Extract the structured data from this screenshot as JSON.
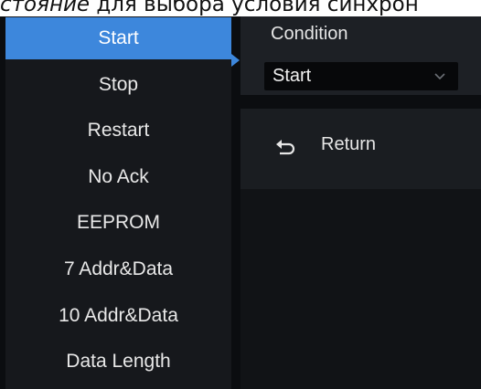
{
  "caption": {
    "italic_text": "стояние",
    "text": " для выбора условия синхрон"
  },
  "menu": {
    "items": [
      {
        "label": "Start",
        "selected": true
      },
      {
        "label": "Stop",
        "selected": false
      },
      {
        "label": "Restart",
        "selected": false
      },
      {
        "label": "No Ack",
        "selected": false
      },
      {
        "label": "EEPROM",
        "selected": false
      },
      {
        "label": "7 Addr&Data",
        "selected": false
      },
      {
        "label": "10 Addr&Data",
        "selected": false
      },
      {
        "label": "Data Length",
        "selected": false
      }
    ]
  },
  "panel": {
    "condition_label": "Condition",
    "condition_value": "Start",
    "return_label": "Return",
    "icons": {
      "dropdown": "chevron-down-icon",
      "return": "return-icon"
    }
  },
  "colors": {
    "accent": "#3d87dc",
    "menu_bg": "#16181c",
    "panel_bg": "#1d2025",
    "select_bg": "#07080a",
    "text": "#e8e8e8"
  }
}
